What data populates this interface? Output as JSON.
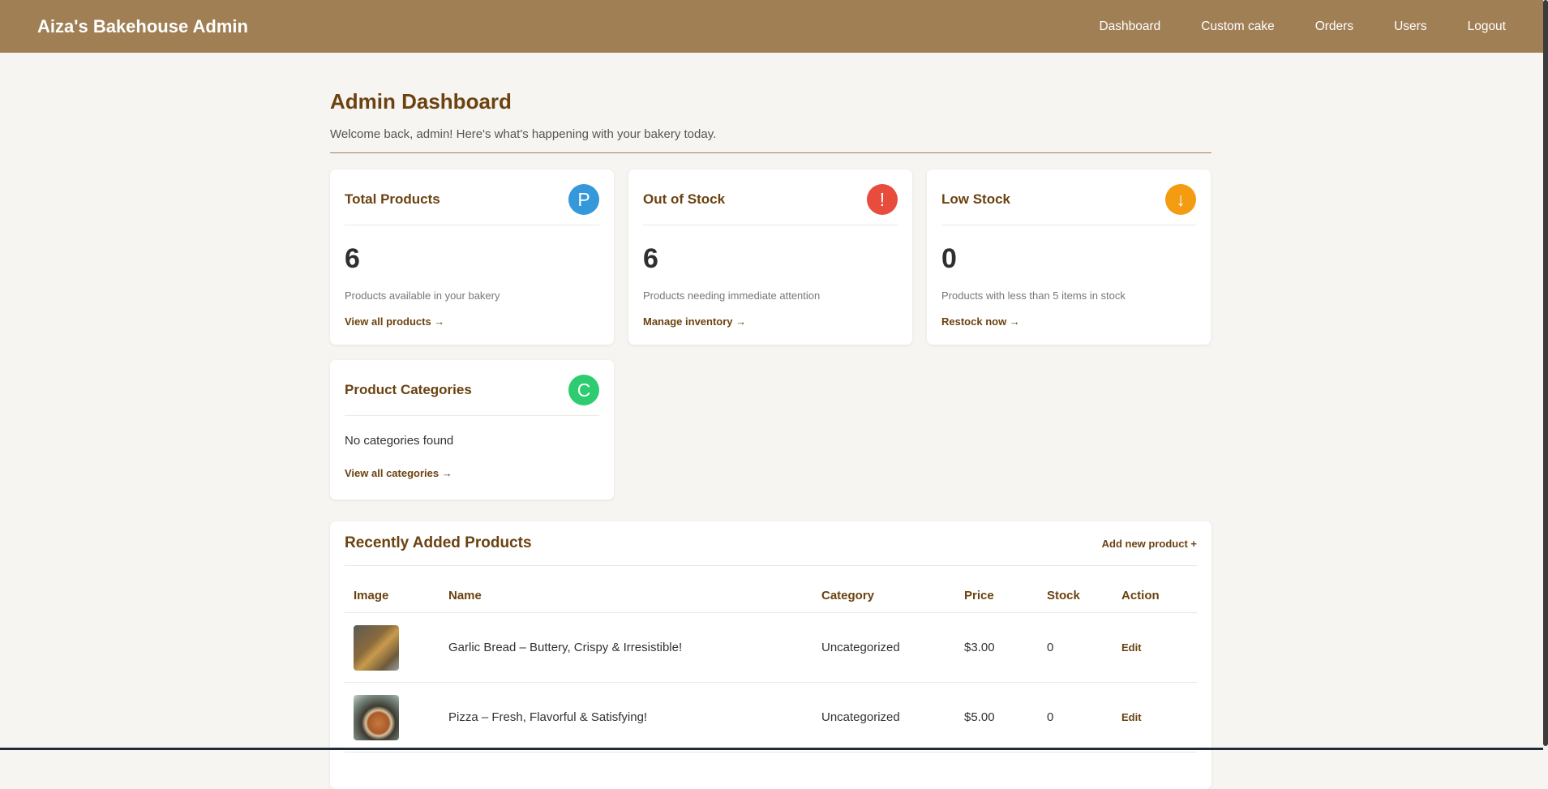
{
  "header": {
    "brand": "Aiza's Bakehouse Admin",
    "nav": [
      "Dashboard",
      "Custom cake",
      "Orders",
      "Users",
      "Logout"
    ]
  },
  "page": {
    "title": "Admin Dashboard",
    "welcome": "Welcome back, admin! Here's what's happening with your bakery today."
  },
  "cards": {
    "total": {
      "title": "Total Products",
      "icon_letter": "P",
      "icon_color": "#3498db",
      "value": "6",
      "desc": "Products available in your bakery",
      "link": "View all products →"
    },
    "out": {
      "title": "Out of Stock",
      "icon_letter": "!",
      "icon_color": "#e74c3c",
      "value": "6",
      "desc": "Products needing immediate attention",
      "link": "Manage inventory →"
    },
    "low": {
      "title": "Low Stock",
      "icon_letter": "↓",
      "icon_color": "#f39c12",
      "value": "0",
      "desc": "Products with less than 5 items in stock",
      "link": "Restock now →"
    },
    "categories": {
      "title": "Product Categories",
      "icon_letter": "C",
      "icon_color": "#2ecc71",
      "empty": "No categories found",
      "link": "View all categories →"
    }
  },
  "recent": {
    "title": "Recently Added Products",
    "add_link": "Add new product +",
    "columns": [
      "Image",
      "Name",
      "Category",
      "Price",
      "Stock",
      "Action"
    ],
    "rows": [
      {
        "image": "garlic-bread-thumbnail",
        "name": "Garlic Bread – Buttery, Crispy & Irresistible!",
        "category": "Uncategorized",
        "price": "$3.00",
        "stock": "0",
        "action": "Edit"
      },
      {
        "image": "pizza-thumbnail",
        "name": "Pizza – Fresh, Flavorful & Satisfying!",
        "category": "Uncategorized",
        "price": "$5.00",
        "stock": "0",
        "action": "Edit"
      }
    ]
  },
  "colors": {
    "header_bg": "#a07f55",
    "accent": "#6b4210",
    "page_bg": "#f7f5f1"
  }
}
